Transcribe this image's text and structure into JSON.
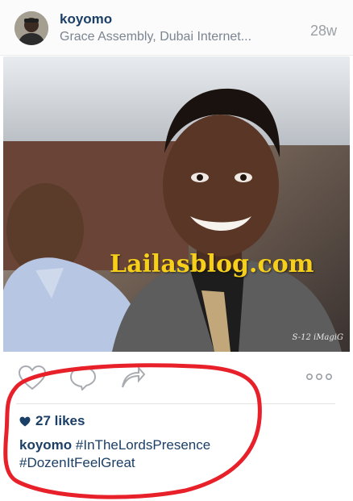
{
  "post": {
    "username": "koyomo",
    "location": "Grace Assembly, Dubai Internet...",
    "time_ago": "28w",
    "watermark": "Lailasblog.com",
    "photographer_tag": "S-12 iMagiG",
    "likes": "27 likes",
    "caption_user": "koyomo",
    "hashtags": [
      "#InTheLordsPresence",
      "#DozenItFeelGreat"
    ]
  },
  "icons": {
    "like": "heart-outline-icon",
    "comment": "speech-bubble-icon",
    "share": "share-arrow-icon",
    "more": "more-dots-icon",
    "likes_heart": "heart-filled-icon"
  },
  "colors": {
    "username": "#1b3f66",
    "meta": "#7b8591",
    "watermark": "#f5cf1a",
    "highlight_loop": "#e8202a"
  }
}
